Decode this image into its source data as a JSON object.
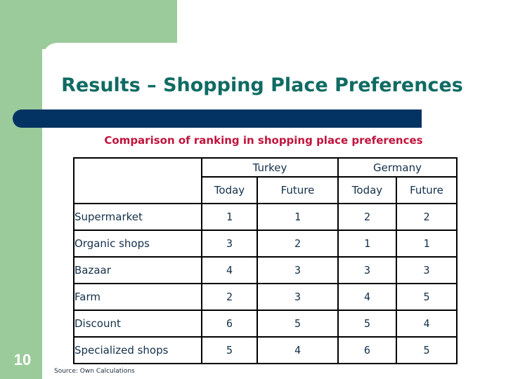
{
  "slide": {
    "title": "Results – Shopping Place Preferences",
    "subtitle": "Comparison of ranking in shopping place preferences",
    "slide_number": "10",
    "source": "Source: Own Calculations",
    "colors": {
      "green": "#9ccb9b",
      "navy_bar": "#033363",
      "title": "#0f6b63",
      "accent": "#c0143c"
    }
  },
  "table": {
    "countries": [
      "Turkey",
      "Germany"
    ],
    "periods": [
      "Today",
      "Future",
      "Today",
      "Future"
    ],
    "rows": [
      {
        "label": "Supermarket",
        "values": [
          "1",
          "1",
          "2",
          "2"
        ]
      },
      {
        "label": "Organic shops",
        "values": [
          "3",
          "2",
          "1",
          "1"
        ]
      },
      {
        "label": "Bazaar",
        "values": [
          "4",
          "3",
          "3",
          "3"
        ]
      },
      {
        "label": "Farm",
        "values": [
          "2",
          "3",
          "4",
          "5"
        ]
      },
      {
        "label": "Discount",
        "values": [
          "6",
          "5",
          "5",
          "4"
        ]
      },
      {
        "label": "Specialized shops",
        "values": [
          "5",
          "4",
          "6",
          "5"
        ]
      }
    ]
  }
}
